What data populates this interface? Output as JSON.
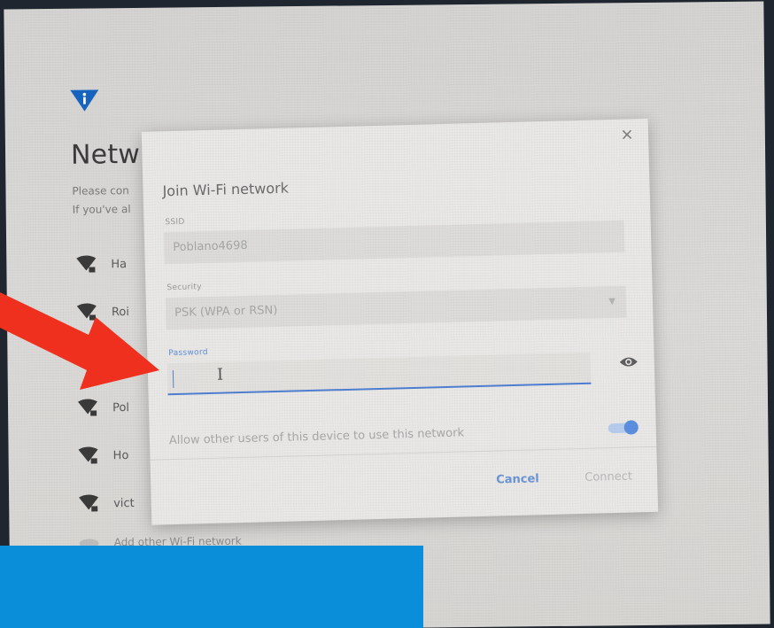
{
  "background_page": {
    "title": "Netw",
    "description_lines": [
      "Please con",
      "If you've al"
    ],
    "networks": [
      {
        "name": "Ha"
      },
      {
        "name": "Roi"
      },
      {
        "name": ""
      },
      {
        "name": "Pol"
      },
      {
        "name": "Ho"
      },
      {
        "name": "vict"
      }
    ],
    "add_network": "Add other Wi-Fi network"
  },
  "dialog": {
    "title": "Join Wi-Fi network",
    "ssid_label": "SSID",
    "ssid_value": "Poblano4698",
    "security_label": "Security",
    "security_value": "PSK (WPA or RSN)",
    "password_label": "Password",
    "password_value": "",
    "allow_label": "Allow other users of this device to use this network",
    "allow_enabled": true,
    "cancel_label": "Cancel",
    "connect_label": "Connect",
    "close_glyph": "×"
  },
  "colors": {
    "accent": "#4f7fd2",
    "annotation_arrow": "#f0301e",
    "caption_bar": "#0a8ed9",
    "info_icon": "#1565c0"
  },
  "icons": [
    "info-shield-icon",
    "wifi-lock-icon",
    "eye-icon",
    "close-icon",
    "chevron-down-icon"
  ]
}
